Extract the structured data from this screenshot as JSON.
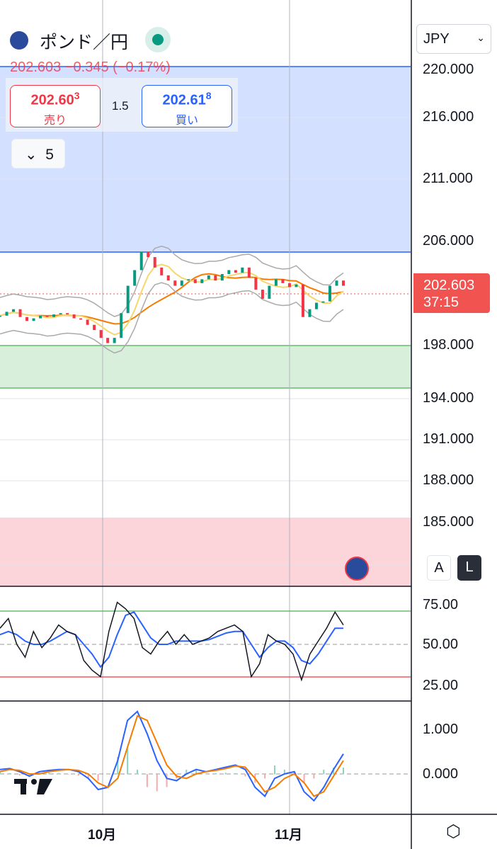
{
  "header": {
    "symbol": "ポンド／円",
    "quote_line": "202.603 −0.345 (−0.17%)",
    "spread": "1.5",
    "collapse_count": "5"
  },
  "sell": {
    "price": "202.60",
    "price_small": "3",
    "label": "売り"
  },
  "buy": {
    "price": "202.61",
    "price_small": "8",
    "label": "買い"
  },
  "currency": "JPY",
  "price_axis": [
    "220.000",
    "216.000",
    "211.000",
    "206.000",
    "198.000",
    "194.000",
    "191.000",
    "188.000",
    "185.000"
  ],
  "last_price": {
    "price": "202.603",
    "countdown": "37:15"
  },
  "scale_buttons": {
    "auto": "A",
    "log": "L"
  },
  "rsi_axis": [
    "75.00",
    "50.00",
    "25.00"
  ],
  "macd_axis": [
    "1.000",
    "0.000"
  ],
  "time_axis": [
    "10月",
    "11月"
  ],
  "colors": {
    "up": "#089981",
    "down": "#f23645",
    "accent": "#2962ff"
  },
  "chart_data": {
    "type": "line",
    "price_close": [
      200.3,
      200.6,
      200.8,
      200.2,
      199.9,
      200.1,
      200.3,
      200.2,
      200.4,
      200.5,
      200.4,
      200.1,
      200.0,
      199.6,
      199.2,
      198.6,
      198.2,
      198.6,
      200.5,
      202.6,
      203.8,
      205.2,
      204.8,
      204.0,
      203.4,
      203.0,
      202.6,
      203.0,
      203.1,
      202.8,
      203.1,
      203.4,
      203.0,
      203.5,
      203.8,
      203.6,
      204.0,
      203.2,
      202.3,
      201.6,
      202.6,
      203.1,
      202.8,
      202.5,
      202.7,
      200.2,
      200.8,
      201.3,
      201.4,
      202.6,
      203.0,
      202.6
    ],
    "rsi": [
      60,
      66,
      50,
      42,
      58,
      48,
      54,
      62,
      58,
      56,
      40,
      34,
      30,
      58,
      76,
      72,
      66,
      48,
      44,
      52,
      58,
      50,
      56,
      50,
      52,
      54,
      58,
      60,
      62,
      58,
      30,
      38,
      56,
      52,
      50,
      44,
      28,
      44,
      52,
      60,
      70,
      62
    ],
    "rsi_ma": [
      56,
      58,
      56,
      52,
      50,
      50,
      52,
      55,
      58,
      56,
      50,
      44,
      36,
      42,
      56,
      68,
      70,
      62,
      54,
      50,
      50,
      52,
      52,
      52,
      52,
      53,
      55,
      57,
      58,
      58,
      50,
      42,
      48,
      52,
      52,
      48,
      40,
      38,
      44,
      52,
      60,
      60
    ],
    "macd": [
      0.1,
      0.12,
      0.05,
      -0.05,
      0.05,
      0.08,
      0.1,
      0.1,
      0.05,
      -0.1,
      -0.35,
      -0.3,
      0.3,
      1.2,
      1.4,
      0.9,
      0.3,
      -0.1,
      -0.15,
      0.0,
      0.1,
      0.05,
      0.1,
      0.15,
      0.2,
      0.1,
      -0.3,
      -0.5,
      -0.1,
      0.0,
      0.05,
      -0.4,
      -0.6,
      -0.3,
      0.1,
      0.45
    ],
    "macd_signal": [
      0.05,
      0.1,
      0.08,
      0.0,
      0.0,
      0.05,
      0.08,
      0.1,
      0.08,
      0.0,
      -0.2,
      -0.3,
      -0.1,
      0.6,
      1.3,
      1.2,
      0.7,
      0.2,
      -0.05,
      -0.1,
      0.0,
      0.05,
      0.08,
      0.12,
      0.18,
      0.15,
      -0.1,
      -0.4,
      -0.3,
      -0.1,
      0.0,
      -0.2,
      -0.5,
      -0.4,
      -0.05,
      0.3
    ]
  }
}
